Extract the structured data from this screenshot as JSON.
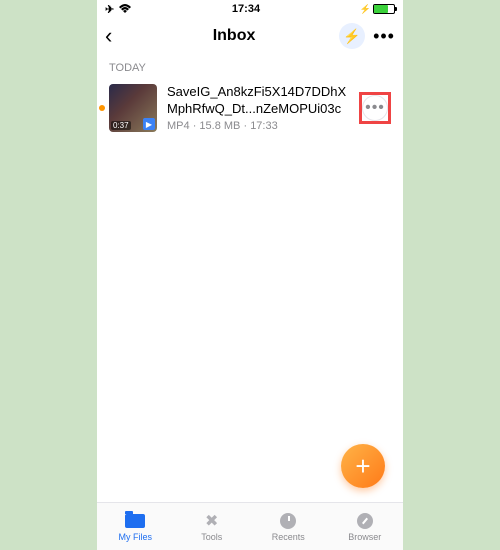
{
  "status_bar": {
    "time": "17:34",
    "airplane_icon": "✈",
    "wifi_icon": "wifi",
    "charging_icon": "⚡"
  },
  "nav": {
    "title": "Inbox",
    "back_glyph": "‹",
    "bolt_glyph": "⚡",
    "more_glyph": "•••"
  },
  "section_label": "TODAY",
  "file": {
    "name": "SaveIG_An8kzFi5X14D7DDhXMphRfwQ_Dt...nZeMOPUi03c",
    "format": "MP4",
    "size": "15.8 MB",
    "time": "17:33",
    "duration": "0:37",
    "more_glyph": "•••",
    "play_glyph": "▶"
  },
  "fab_glyph": "+",
  "tabs": {
    "files": "My Files",
    "tools": "Tools",
    "recents": "Recents",
    "browser": "Browser"
  }
}
